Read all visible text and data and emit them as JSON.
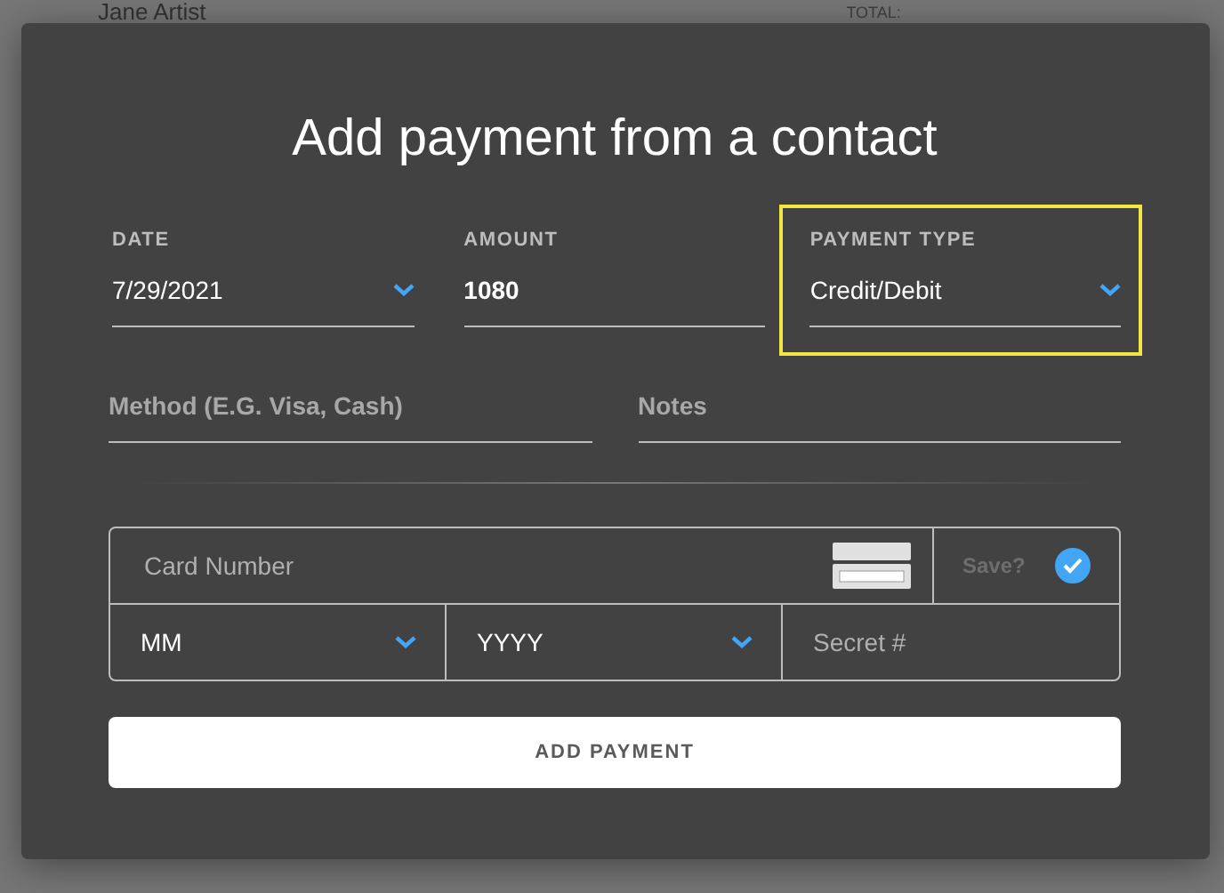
{
  "background": {
    "name": "Jane Artist",
    "total_label": "TOTAL:"
  },
  "dialog": {
    "title": "Add payment from a contact"
  },
  "fields": [
    {
      "label": "DATE",
      "value": "7/29/2021",
      "kind": "select",
      "highlighted": false
    },
    {
      "label": "AMOUNT",
      "value": "1080",
      "kind": "text",
      "highlighted": false
    },
    {
      "label": "PAYMENT TYPE",
      "value": "Credit/Debit",
      "kind": "select",
      "highlighted": true
    }
  ],
  "method": {
    "placeholder": "Method (E.G. Visa, Cash)"
  },
  "notes": {
    "placeholder": "Notes"
  },
  "card": {
    "number_placeholder": "Card Number",
    "save_label": "Save?",
    "save_checked": true,
    "month": {
      "value": "MM",
      "kind": "select"
    },
    "year": {
      "value": "YYYY",
      "kind": "select"
    },
    "secret": {
      "placeholder": "Secret #"
    }
  },
  "submit": {
    "label": "ADD PAYMENT"
  }
}
